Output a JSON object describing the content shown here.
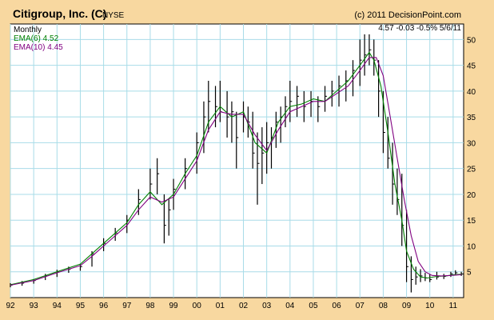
{
  "header": {
    "title": "Citigroup, Inc. (C)",
    "exchange": "NYSE",
    "copyright": "(c) 2011 DecisionPoint.com",
    "quote": "4.57  -0.03  -0.5%  5/6/11",
    "period": "Monthly",
    "ema6_label": "EMA(6) 4.52",
    "ema10_label": "EMA(10) 4.45"
  },
  "colors": {
    "background": "#F8D8A0",
    "plot_bg": "#FFFFFF",
    "grid": "#A8DCE8",
    "price": "#000000",
    "ema6": "#008000",
    "ema10": "#800080"
  },
  "chart_data": {
    "type": "line",
    "title": "Citigroup, Inc. (C)",
    "period": "Monthly",
    "x_tick_labels": [
      "92",
      "93",
      "94",
      "95",
      "96",
      "97",
      "98",
      "99",
      "00",
      "01",
      "02",
      "03",
      "04",
      "05",
      "06",
      "07",
      "08",
      "09",
      "10",
      "11"
    ],
    "y_ticks": [
      5,
      10,
      15,
      20,
      25,
      30,
      35,
      40,
      45,
      50
    ],
    "ylim": [
      0,
      53
    ],
    "xlim": [
      1992.0,
      2011.45
    ],
    "grid": true,
    "series": [
      {
        "name": "EMA(6) 4.52",
        "points": [
          [
            1992.0,
            2.5
          ],
          [
            1993.0,
            3.5
          ],
          [
            1994.0,
            5.0
          ],
          [
            1995.0,
            6.5
          ],
          [
            1995.5,
            8.5
          ],
          [
            1996.0,
            10.5
          ],
          [
            1996.5,
            12.5
          ],
          [
            1997.0,
            14.5
          ],
          [
            1997.5,
            18.0
          ],
          [
            1998.0,
            20.5
          ],
          [
            1998.5,
            18.0
          ],
          [
            1999.0,
            20.0
          ],
          [
            1999.5,
            24.0
          ],
          [
            2000.0,
            27.5
          ],
          [
            2000.5,
            34.0
          ],
          [
            2001.0,
            37.0
          ],
          [
            2001.5,
            35.0
          ],
          [
            2002.0,
            36.0
          ],
          [
            2002.5,
            30.0
          ],
          [
            2003.0,
            28.0
          ],
          [
            2003.5,
            34.0
          ],
          [
            2004.0,
            37.0
          ],
          [
            2004.5,
            37.5
          ],
          [
            2005.0,
            38.5
          ],
          [
            2005.5,
            38.0
          ],
          [
            2006.0,
            40.0
          ],
          [
            2006.5,
            42.0
          ],
          [
            2007.0,
            45.0
          ],
          [
            2007.4,
            47.5
          ],
          [
            2007.6,
            46.0
          ],
          [
            2007.9,
            41.0
          ],
          [
            2008.2,
            32.0
          ],
          [
            2008.5,
            22.0
          ],
          [
            2008.8,
            15.0
          ],
          [
            2009.0,
            9.0
          ],
          [
            2009.3,
            5.5
          ],
          [
            2009.6,
            4.0
          ],
          [
            2009.9,
            3.8
          ],
          [
            2010.3,
            4.1
          ],
          [
            2010.7,
            4.2
          ],
          [
            2011.0,
            4.4
          ],
          [
            2011.35,
            4.52
          ]
        ]
      },
      {
        "name": "EMA(10) 4.45",
        "points": [
          [
            1992.0,
            2.4
          ],
          [
            1993.0,
            3.3
          ],
          [
            1994.0,
            4.8
          ],
          [
            1995.0,
            6.2
          ],
          [
            1995.5,
            8.0
          ],
          [
            1996.0,
            10.0
          ],
          [
            1996.5,
            12.0
          ],
          [
            1997.0,
            14.0
          ],
          [
            1997.5,
            17.0
          ],
          [
            1998.0,
            19.5
          ],
          [
            1998.5,
            18.5
          ],
          [
            1999.0,
            19.5
          ],
          [
            1999.5,
            23.0
          ],
          [
            2000.0,
            26.5
          ],
          [
            2000.5,
            32.5
          ],
          [
            2001.0,
            36.0
          ],
          [
            2001.5,
            35.5
          ],
          [
            2002.0,
            35.5
          ],
          [
            2002.5,
            31.5
          ],
          [
            2003.0,
            28.5
          ],
          [
            2003.5,
            32.5
          ],
          [
            2004.0,
            36.0
          ],
          [
            2004.5,
            37.0
          ],
          [
            2005.0,
            38.0
          ],
          [
            2005.5,
            38.0
          ],
          [
            2006.0,
            39.5
          ],
          [
            2006.5,
            41.0
          ],
          [
            2007.0,
            44.0
          ],
          [
            2007.4,
            46.5
          ],
          [
            2007.7,
            46.5
          ],
          [
            2008.0,
            43.0
          ],
          [
            2008.3,
            35.0
          ],
          [
            2008.6,
            27.0
          ],
          [
            2008.9,
            19.0
          ],
          [
            2009.2,
            12.0
          ],
          [
            2009.5,
            7.0
          ],
          [
            2009.8,
            5.0
          ],
          [
            2010.1,
            4.3
          ],
          [
            2010.5,
            4.2
          ],
          [
            2010.9,
            4.3
          ],
          [
            2011.35,
            4.45
          ]
        ]
      }
    ],
    "price_bars": [
      [
        1992.0,
        2.0,
        2.8,
        2.4
      ],
      [
        1992.5,
        2.3,
        3.2,
        2.8
      ],
      [
        1993.0,
        2.7,
        3.6,
        3.3
      ],
      [
        1993.5,
        3.4,
        4.6,
        4.2
      ],
      [
        1994.0,
        4.0,
        5.4,
        5.0
      ],
      [
        1994.5,
        4.8,
        6.0,
        5.5
      ],
      [
        1995.0,
        5.2,
        6.5,
        6.0
      ],
      [
        1995.5,
        6.0,
        9.0,
        8.5
      ],
      [
        1996.0,
        9.0,
        11.5,
        10.5
      ],
      [
        1996.5,
        11.0,
        13.5,
        12.5
      ],
      [
        1997.0,
        12.5,
        16.0,
        15.0
      ],
      [
        1997.5,
        16.0,
        21.0,
        19.0
      ],
      [
        1998.0,
        19.0,
        25.0,
        22.0
      ],
      [
        1998.3,
        20.0,
        27.0,
        24.0
      ],
      [
        1998.6,
        10.5,
        20.0,
        14.0
      ],
      [
        1998.8,
        12.0,
        19.0,
        17.0
      ],
      [
        1999.0,
        17.0,
        23.0,
        21.0
      ],
      [
        1999.5,
        21.0,
        27.0,
        25.0
      ],
      [
        2000.0,
        24.0,
        32.0,
        30.0
      ],
      [
        2000.3,
        28.0,
        38.0,
        35.0
      ],
      [
        2000.5,
        32.0,
        42.0,
        38.0
      ],
      [
        2000.8,
        33.0,
        41.0,
        37.0
      ],
      [
        2001.0,
        34.0,
        42.0,
        36.0
      ],
      [
        2001.3,
        31.0,
        40.0,
        35.0
      ],
      [
        2001.5,
        30.0,
        38.0,
        36.0
      ],
      [
        2001.7,
        25.0,
        36.0,
        31.0
      ],
      [
        2002.0,
        32.0,
        38.0,
        35.0
      ],
      [
        2002.2,
        31.0,
        37.0,
        34.0
      ],
      [
        2002.4,
        25.0,
        36.0,
        28.0
      ],
      [
        2002.6,
        18.0,
        32.0,
        26.0
      ],
      [
        2002.8,
        22.0,
        33.0,
        28.0
      ],
      [
        2003.0,
        24.0,
        34.0,
        30.0
      ],
      [
        2003.2,
        25.0,
        33.0,
        31.0
      ],
      [
        2003.4,
        29.0,
        36.0,
        34.0
      ],
      [
        2003.6,
        30.0,
        37.0,
        35.0
      ],
      [
        2003.8,
        33.0,
        39.0,
        37.0
      ],
      [
        2004.0,
        34.0,
        42.0,
        38.0
      ],
      [
        2004.3,
        35.0,
        41.0,
        39.0
      ],
      [
        2004.6,
        34.0,
        40.0,
        37.0
      ],
      [
        2004.9,
        35.0,
        40.0,
        38.0
      ],
      [
        2005.2,
        34.0,
        39.0,
        37.0
      ],
      [
        2005.5,
        36.0,
        41.0,
        39.0
      ],
      [
        2005.8,
        37.0,
        42.0,
        40.0
      ],
      [
        2006.1,
        37.0,
        43.0,
        41.0
      ],
      [
        2006.4,
        38.0,
        44.0,
        42.0
      ],
      [
        2006.7,
        39.0,
        46.0,
        44.0
      ],
      [
        2007.0,
        41.0,
        50.0,
        46.0
      ],
      [
        2007.2,
        43.0,
        51.0,
        47.0
      ],
      [
        2007.4,
        45.0,
        51.0,
        48.0
      ],
      [
        2007.6,
        43.0,
        50.0,
        46.0
      ],
      [
        2007.8,
        35.0,
        46.0,
        40.0
      ],
      [
        2008.0,
        28.0,
        40.0,
        32.0
      ],
      [
        2008.2,
        25.0,
        35.0,
        27.0
      ],
      [
        2008.4,
        18.0,
        30.0,
        22.0
      ],
      [
        2008.6,
        16.0,
        25.0,
        19.0
      ],
      [
        2008.8,
        10.0,
        24.0,
        14.0
      ],
      [
        2009.0,
        3.0,
        17.0,
        6.0
      ],
      [
        2009.2,
        1.0,
        8.0,
        3.5
      ],
      [
        2009.4,
        2.5,
        6.0,
        4.0
      ],
      [
        2009.6,
        3.0,
        5.5,
        4.2
      ],
      [
        2009.8,
        3.2,
        4.8,
        3.8
      ],
      [
        2010.0,
        3.0,
        4.5,
        3.5
      ],
      [
        2010.3,
        3.5,
        5.0,
        4.0
      ],
      [
        2010.6,
        3.6,
        4.6,
        4.1
      ],
      [
        2010.9,
        4.0,
        5.0,
        4.6
      ],
      [
        2011.1,
        4.3,
        5.3,
        4.8
      ],
      [
        2011.35,
        4.2,
        5.0,
        4.57
      ]
    ]
  }
}
